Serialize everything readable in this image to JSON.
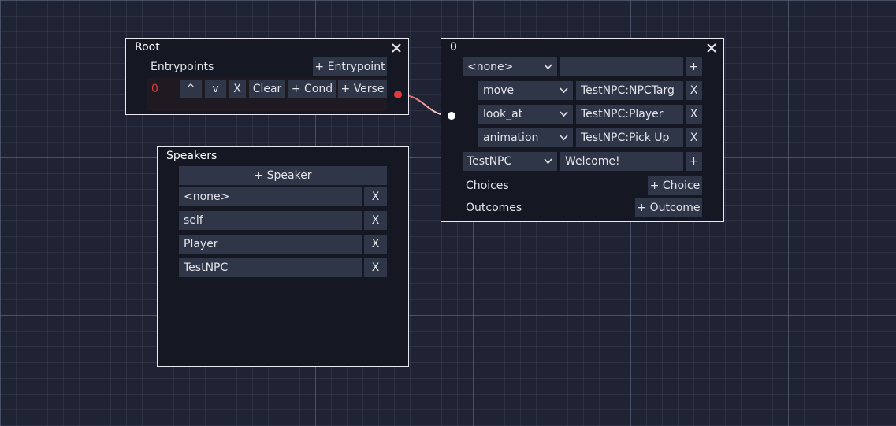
{
  "colors": {
    "background": "#1f2333",
    "node_bg": "#151822",
    "node_border": "#e8e8ee",
    "button_bg": "#2f3648",
    "port_out": "#e0393e",
    "port_in": "#ffffff",
    "entry_index": "#e0393e"
  },
  "root": {
    "title": "Root",
    "close_icon": "close-icon",
    "entrypoints_label": "Entrypoints",
    "add_entrypoint": "+ Entrypoint",
    "entry": {
      "index": "0",
      "up": "^",
      "down": "v",
      "remove": "X",
      "clear": "Clear",
      "add_cond": "+ Cond",
      "add_verse": "+ Verse"
    }
  },
  "speakers": {
    "title": "Speakers",
    "add_speaker": "+ Speaker",
    "items": [
      {
        "name": "<none>",
        "remove": "X"
      },
      {
        "name": "self",
        "remove": "X"
      },
      {
        "name": "Player",
        "remove": "X"
      },
      {
        "name": "TestNPC",
        "remove": "X"
      }
    ]
  },
  "verse": {
    "title": "0",
    "header_speaker": "<none>",
    "header_text": "",
    "header_add": "+",
    "actions": [
      {
        "type": "move",
        "target": "TestNPC:NPCTarg",
        "remove": "X"
      },
      {
        "type": "look_at",
        "target": "TestNPC:Player",
        "remove": "X"
      },
      {
        "type": "animation",
        "target": "TestNPC:Pick Up",
        "remove": "X"
      }
    ],
    "line_speaker": "TestNPC",
    "line_text": "Welcome!",
    "line_add": "+",
    "choices_label": "Choices",
    "add_choice": "+ Choice",
    "outcomes_label": "Outcomes",
    "add_outcome": "+ Outcome"
  }
}
